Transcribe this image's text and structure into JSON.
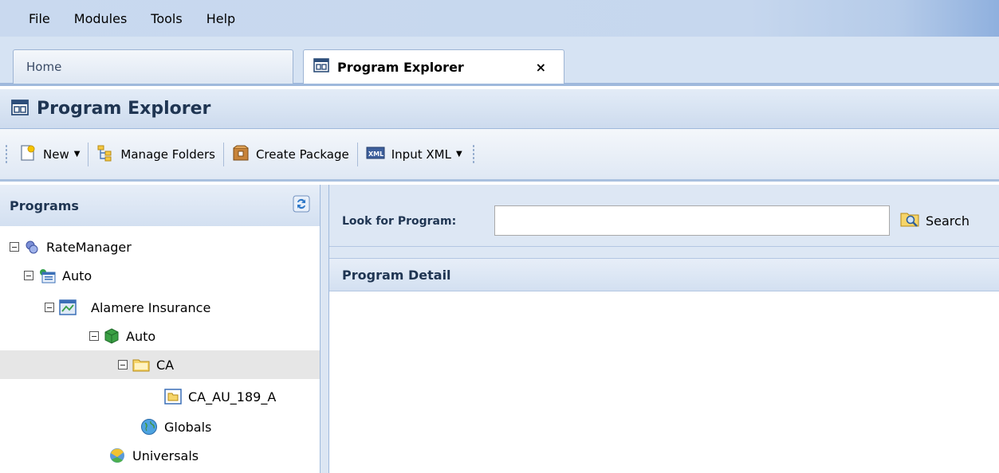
{
  "menubar": {
    "items": [
      {
        "label": "File"
      },
      {
        "label": "Modules"
      },
      {
        "label": "Tools"
      },
      {
        "label": "Help"
      }
    ]
  },
  "tabs": {
    "home": {
      "label": "Home"
    },
    "program_explorer": {
      "label": "Program Explorer",
      "close": "×"
    }
  },
  "panel": {
    "title": "Program Explorer"
  },
  "toolbar": {
    "new_label": "New",
    "manage_folders_label": "Manage Folders",
    "create_package_label": "Create Package",
    "input_xml_label": "Input XML"
  },
  "left": {
    "title": "Programs",
    "tree": [
      {
        "label": "RateManager",
        "icon": "rate-manager-icon",
        "expanded": true
      },
      {
        "label": "Auto",
        "icon": "line-of-business-icon",
        "expanded": true
      },
      {
        "label": "Alamere Insurance",
        "icon": "company-icon",
        "expanded": true
      },
      {
        "label": "Auto",
        "icon": "product-icon",
        "expanded": true
      },
      {
        "label": "CA",
        "icon": "folder-icon",
        "expanded": true,
        "selected": true
      },
      {
        "label": "CA_AU_189_A",
        "icon": "program-icon"
      },
      {
        "label": "Globals",
        "icon": "globe-icon"
      },
      {
        "label": "Universals",
        "icon": "universals-icon"
      }
    ]
  },
  "search": {
    "label": "Look for Program:",
    "value": "",
    "button_label": "Search"
  },
  "detail": {
    "title": "Program Detail"
  },
  "colors": {
    "header_blue": "#c9d9ef",
    "title_text": "#1f3552",
    "selection": "#e6e6e6"
  }
}
